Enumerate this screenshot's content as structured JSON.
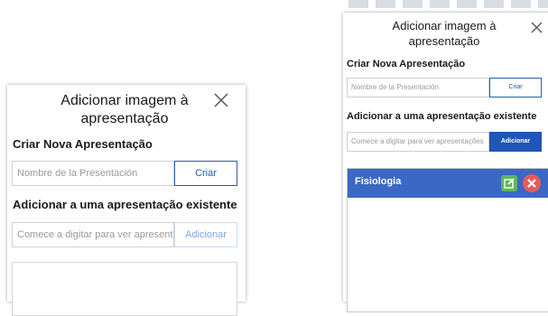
{
  "dialogs": {
    "left": {
      "title_line1": "Adicionar imagem à",
      "title_line2": "apresentação",
      "create_label": "Criar Nova Apresentação",
      "name_placeholder": "Nombre de la Presentación",
      "create_button": "Criar",
      "add_existing_label": "Adicionar a uma apresentação existente",
      "search_placeholder": "Comece a digitar para ver apresentações",
      "add_button": "Adicionar"
    },
    "right": {
      "title_line1": "Adicionar imagem à",
      "title_line2": "apresentação",
      "create_label": "Criar Nova Apresentação",
      "name_placeholder": "Nombre de la Presentación",
      "create_button": "Criar",
      "add_existing_label": "Adicionar a uma apresentação existente",
      "search_placeholder": "Comece a digitar para ver apresentações",
      "add_button": "Adicionar",
      "presentations": [
        {
          "name": "Fisiologia",
          "edit_icon": "edit-icon",
          "delete_icon": "delete-icon"
        }
      ]
    }
  },
  "colors": {
    "primary_blue": "#1f56b7",
    "list_item_blue": "#3a68c4",
    "edit_green": "#5cb85c",
    "delete_red": "#e85b5b"
  },
  "icons": {
    "close": "close-icon"
  }
}
